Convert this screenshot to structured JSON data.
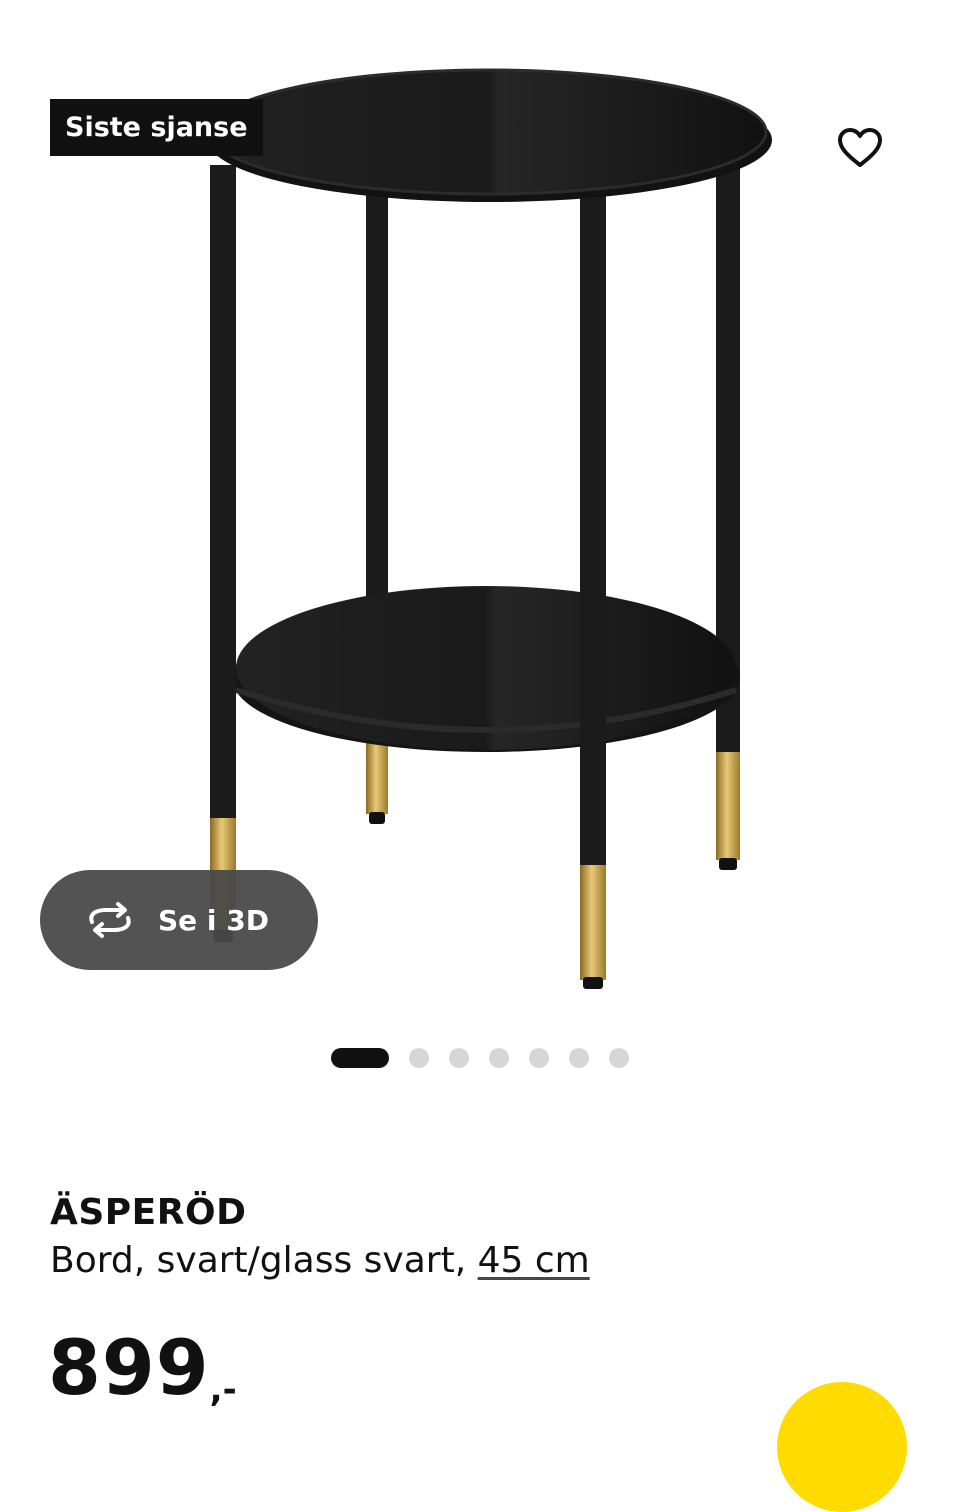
{
  "badge": {
    "label": "Siste sjanse"
  },
  "view3d": {
    "label": "Se i 3D"
  },
  "gallery": {
    "total_images": 7,
    "active_index": 0
  },
  "product": {
    "name": "ÄSPERÖD",
    "description": "Bord, svart/glass svart, ",
    "size_link": "45 cm",
    "price_int": "899",
    "price_dec": ",-"
  },
  "colors": {
    "accent_yellow": "#FFDB00",
    "badge_bg": "#111111",
    "dot_inactive": "#d6d6d6"
  },
  "icons": {
    "favorite": "heart-outline-icon",
    "rotate3d": "rotate-3d-icon"
  }
}
